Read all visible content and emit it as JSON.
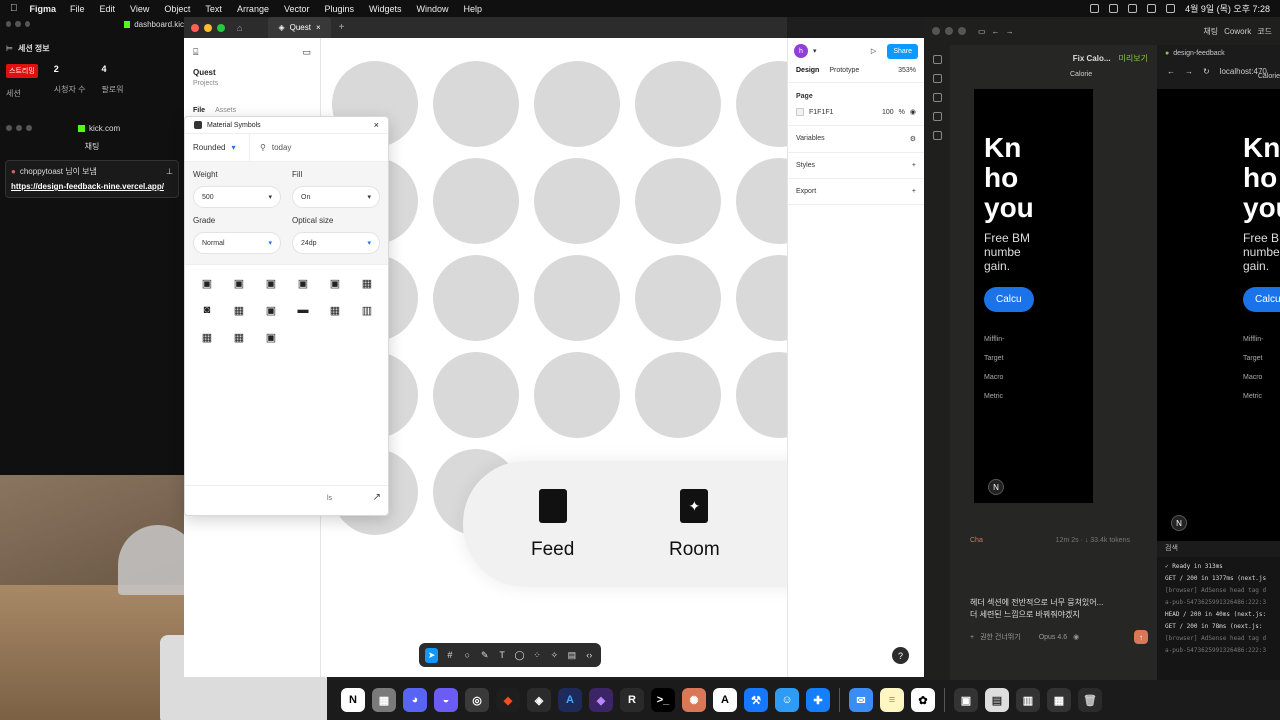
{
  "menubar": {
    "app": "Figma",
    "items": [
      "File",
      "Edit",
      "View",
      "Object",
      "Text",
      "Arrange",
      "Vector",
      "Plugins",
      "Widgets",
      "Window",
      "Help"
    ],
    "pill": "",
    "clock": "4월 9일 (목) 오후 7:28"
  },
  "left_panel": {
    "session_title": "세션 정보",
    "live_badge": "스트리밍",
    "session_label": "세션",
    "viewers_num": "2",
    "viewers_label": "시청자 수",
    "followers_num": "4",
    "followers_label": "팔로워",
    "kick_site": "kick.com",
    "chat_label": "채팅",
    "chat_user": "choppytoast 님이 보냄",
    "chat_link": "https://design-feedback-nine.vercel.app/"
  },
  "figma": {
    "tab_title": "Quest",
    "project_name": "Quest",
    "project_sub": "Projects",
    "tab_file": "File",
    "tab_assets": "Assets",
    "browser_tab": "dashboard.kic"
  },
  "material_symbols": {
    "title": "Material Symbols",
    "style": "Rounded",
    "query": "today",
    "weight_label": "Weight",
    "weight_value": "500",
    "fill_label": "Fill",
    "fill_value": "On",
    "grade_label": "Grade",
    "grade_value": "Normal",
    "optical_label": "Optical size",
    "optical_value": "24dp",
    "footer_text": "ls"
  },
  "canvas": {
    "tabs": [
      {
        "label": "Feed",
        "icon": "square-icon"
      },
      {
        "label": "Room",
        "icon": "sparkle-icon"
      }
    ]
  },
  "right_panel": {
    "avatar": "h",
    "share": "Share",
    "tab_design": "Design",
    "tab_prototype": "Prototype",
    "zoom": "353%",
    "page_label": "Page",
    "page_color": "F1F1F1",
    "page_opacity": "100",
    "page_unit": "%",
    "variables": "Variables",
    "styles": "Styles",
    "export": "Export"
  },
  "right_app": {
    "tab_chat": "채팅",
    "tab_cowork": "Cowork",
    "tab_code": "코드",
    "session_title": "Fix Calo...",
    "preview_label": "미리보기",
    "preview_url_short": "Calorie",
    "hero": "Kn ho you",
    "hero_lines": [
      "Kn",
      "ho",
      "you"
    ],
    "sub_lines": [
      "Free BM",
      "numbe",
      "gain."
    ],
    "cta": "Calcu",
    "list": [
      "Mifflin-",
      "Target",
      "Macro",
      "Metric"
    ],
    "status_left": "Cha",
    "status_right": "12m 2s · ↓ 33.4k tokens",
    "message_line1": "헤더 섹션에 전반적으로 너무 뭉쳐있어...",
    "message_line2": "더 세련된 느낌으로 바꿔줘야겠지",
    "permission_label": "권한 건너뛰기",
    "model": "Opus 4.6"
  },
  "browser": {
    "tab": "design-feedback",
    "url": "localhost:470",
    "url_title": "Calorie",
    "hero_lines": [
      "Kn",
      "ho",
      "you"
    ],
    "sub_lines": [
      "Free BM",
      "numbe",
      "gain."
    ],
    "cta": "Calcu",
    "list": [
      "Mifflin-",
      "Target",
      "Macro",
      "Metric"
    ]
  },
  "terminal": {
    "header": "검색",
    "lines": [
      "✓ Ready in 313ms",
      "GET / 200 in 1377ms (next.js",
      "[browser] AdSense head tag d",
      "a-pub-5473625991326486:222:3",
      "HEAD / 200 in 40ms (next.js:",
      "GET / 200 in 78ms (next.js:",
      "[browser] AdSense head tag d",
      "a-pub-5473625991326486:222:3"
    ]
  },
  "dock": {
    "apps": [
      {
        "icon": "notion-icon",
        "glyph": "N",
        "color": "#ffffff",
        "fg": "#000000"
      },
      {
        "icon": "calculator-icon",
        "glyph": "▦",
        "color": "#7a7a7a",
        "fg": "#ffffff"
      },
      {
        "icon": "discord-icon",
        "glyph": "◕",
        "color": "#5865f2",
        "fg": "#ffffff"
      },
      {
        "icon": "messenger-icon",
        "glyph": "◒",
        "color": "#6b5cf6",
        "fg": "#ffffff"
      },
      {
        "icon": "obs-icon",
        "glyph": "◎",
        "color": "#3a3a3a",
        "fg": "#ffffff"
      },
      {
        "icon": "figma-icon",
        "glyph": "◆",
        "color": "#1e1e1e",
        "fg": "#f24e1e"
      },
      {
        "icon": "box-icon",
        "glyph": "◈",
        "color": "#2b2b2b",
        "fg": "#ffffff"
      },
      {
        "icon": "affinity-icon",
        "glyph": "A",
        "color": "#1e2a5a",
        "fg": "#4aa4ff"
      },
      {
        "icon": "gem-icon",
        "glyph": "◆",
        "color": "#3b2566",
        "fg": "#b887ff"
      },
      {
        "icon": "r-icon",
        "glyph": "R",
        "color": "#2a2a2a",
        "fg": "#ffffff"
      },
      {
        "icon": "terminal-icon",
        "glyph": ">_",
        "color": "#000000",
        "fg": "#ffffff"
      },
      {
        "icon": "claude-icon",
        "glyph": "✺",
        "color": "#d97757",
        "fg": "#ffffff"
      },
      {
        "icon": "fonts-icon",
        "glyph": "A",
        "color": "#ffffff",
        "fg": "#000000"
      },
      {
        "icon": "xcode-icon",
        "glyph": "⚒",
        "color": "#1677ff",
        "fg": "#ffffff"
      },
      {
        "icon": "finder-icon",
        "glyph": "☺",
        "color": "#2e9cf5",
        "fg": "#ffffff"
      },
      {
        "icon": "xcode-blue-icon",
        "glyph": "✚",
        "color": "#147efb",
        "fg": "#ffffff"
      },
      {
        "icon": "mail-icon",
        "glyph": "✉",
        "color": "#3b8cf5",
        "fg": "#ffffff"
      },
      {
        "icon": "notes-icon",
        "glyph": "≡",
        "color": "#fff6c2",
        "fg": "#b89b00"
      },
      {
        "icon": "chatgpt-icon",
        "glyph": "✿",
        "color": "#ffffff",
        "fg": "#000000"
      },
      {
        "icon": "window-icon",
        "glyph": "▣",
        "color": "#333333",
        "fg": "#ffffff"
      },
      {
        "icon": "window-icon-2",
        "glyph": "▤",
        "color": "#dddddd",
        "fg": "#333333"
      },
      {
        "icon": "window-icon-3",
        "glyph": "▥",
        "color": "#333333",
        "fg": "#ffffff"
      },
      {
        "icon": "window-icon-4",
        "glyph": "▦",
        "color": "#333333",
        "fg": "#ffffff"
      },
      {
        "icon": "trash-icon",
        "glyph": "🗑",
        "color": "#2b2b2b",
        "fg": "#cccccc"
      }
    ]
  }
}
